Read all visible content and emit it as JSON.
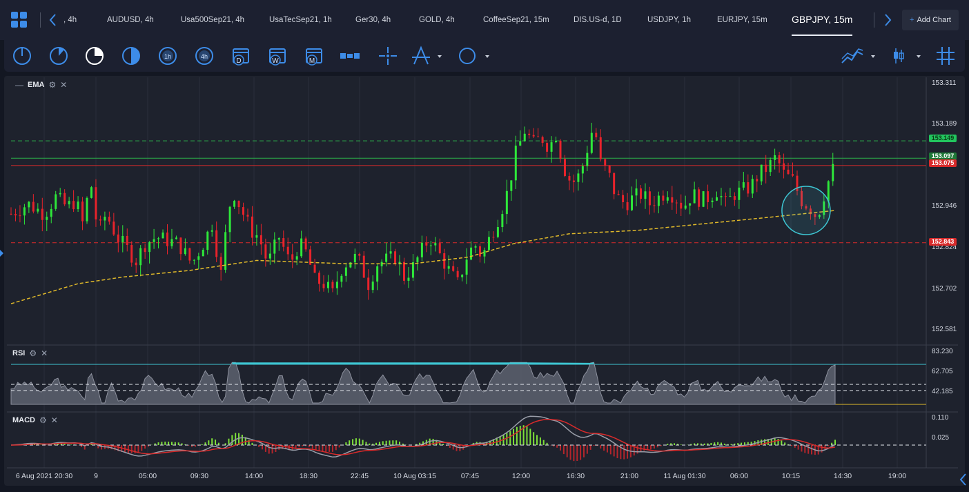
{
  "tabs": [
    {
      "label": ", 4h",
      "x": 92
    },
    {
      "label": "AUDUSD, 4h",
      "x": 155
    },
    {
      "label": "Usa500Sep21, 4h",
      "x": 262
    },
    {
      "label": "UsaTecSep21, 1h",
      "x": 390
    },
    {
      "label": "Ger30, 4h",
      "x": 515
    },
    {
      "label": "GOLD, 4h",
      "x": 607
    },
    {
      "label": "CoffeeSep21, 15m",
      "x": 700
    },
    {
      "label": "DIS.US-d, 1D",
      "x": 831
    },
    {
      "label": "USDJPY, 1h",
      "x": 938
    },
    {
      "label": "EURJPY, 15m",
      "x": 1039
    },
    {
      "label": "GBPJPY, 15m",
      "x": 1147,
      "active": true
    }
  ],
  "add_chart_label": "Add Chart",
  "toolbar": {
    "tools": [
      {
        "name": "period-1-icon",
        "label": ""
      },
      {
        "name": "period-2-icon",
        "label": ""
      },
      {
        "name": "period-3-icon",
        "label": ""
      },
      {
        "name": "period-half-icon",
        "label": ""
      },
      {
        "name": "period-1h-icon",
        "label": "1h"
      },
      {
        "name": "period-4h-icon",
        "label": "4h"
      },
      {
        "name": "calendar-day-icon",
        "label": "D"
      },
      {
        "name": "calendar-week-icon",
        "label": "W"
      },
      {
        "name": "calendar-month-icon",
        "label": "M"
      }
    ]
  },
  "indicators": {
    "ema_label": "EMA",
    "rsi_label": "RSI",
    "macd_label": "MACD"
  },
  "price_axis": [
    "153.311",
    "153.189",
    "152.946",
    "152.824",
    "152.702",
    "152.581"
  ],
  "price_tags": [
    {
      "value": "153.149",
      "color": "#22c55e",
      "text_color": "#0b3d17"
    },
    {
      "value": "153.097",
      "color": "#1f7a38",
      "text_color": "#ffffff"
    },
    {
      "value": "153.075",
      "color": "#d92b2b",
      "text_color": "#ffffff"
    },
    {
      "value": "152.843",
      "color": "#d92b2b",
      "text_color": "#ffffff"
    }
  ],
  "rsi_axis": [
    "83.230",
    "62.705",
    "42.185"
  ],
  "macd_axis": [
    "0.110",
    "0.025"
  ],
  "time_axis": [
    "6 Aug 2021 20:30",
    "9",
    "05:00",
    "09:30",
    "14:00",
    "18:30",
    "22:45",
    "10 Aug 03:15",
    "07:45",
    "12:00",
    "16:30",
    "21:00",
    "11 Aug 01:30",
    "06:00",
    "10:15",
    "14:30",
    "19:00"
  ],
  "colors": {
    "up": "#2ee83a",
    "down": "#e8232b",
    "ema": "#e0b92a",
    "accent": "#3d8ce8",
    "circle": "#3ec7d4"
  },
  "chart_data": {
    "type": "candlestick",
    "symbol": "GBPJPY, 15m",
    "ylim": [
      152.54,
      153.34
    ],
    "horizontal_lines": [
      {
        "value": 153.149,
        "color": "green",
        "style": "dashed"
      },
      {
        "value": 153.097,
        "color": "green",
        "style": "solid"
      },
      {
        "value": 153.075,
        "color": "red",
        "style": "solid"
      },
      {
        "value": 152.843,
        "color": "red",
        "style": "dashed"
      }
    ],
    "close_path": [
      [
        0,
        152.93
      ],
      [
        15,
        152.96
      ],
      [
        30,
        152.93
      ],
      [
        40,
        152.98
      ],
      [
        50,
        152.95
      ],
      [
        58,
        152.97
      ],
      [
        66,
        152.88
      ],
      [
        70,
        153.06
      ],
      [
        78,
        152.87
      ],
      [
        85,
        152.93
      ],
      [
        95,
        152.86
      ],
      [
        105,
        152.82
      ],
      [
        112,
        152.79
      ],
      [
        120,
        152.84
      ],
      [
        130,
        152.86
      ],
      [
        140,
        152.85
      ],
      [
        150,
        152.84
      ],
      [
        162,
        152.78
      ],
      [
        172,
        152.84
      ],
      [
        180,
        152.9
      ],
      [
        188,
        152.75
      ],
      [
        195,
        152.95
      ],
      [
        200,
        152.99
      ],
      [
        208,
        152.93
      ],
      [
        215,
        152.88
      ],
      [
        222,
        152.86
      ],
      [
        230,
        152.78
      ],
      [
        240,
        152.86
      ],
      [
        250,
        152.78
      ],
      [
        258,
        152.84
      ],
      [
        265,
        152.81
      ],
      [
        272,
        152.73
      ],
      [
        280,
        152.72
      ],
      [
        288,
        152.69
      ],
      [
        295,
        152.76
      ],
      [
        302,
        152.79
      ],
      [
        310,
        152.8
      ],
      [
        320,
        152.72
      ],
      [
        328,
        152.78
      ],
      [
        335,
        152.79
      ],
      [
        345,
        152.8
      ],
      [
        352,
        152.74
      ],
      [
        360,
        152.77
      ],
      [
        368,
        152.82
      ],
      [
        375,
        152.86
      ],
      [
        385,
        152.8
      ],
      [
        392,
        152.76
      ],
      [
        400,
        152.72
      ],
      [
        408,
        152.8
      ],
      [
        415,
        152.84
      ],
      [
        422,
        152.8
      ],
      [
        430,
        152.87
      ],
      [
        438,
        152.93
      ],
      [
        445,
        153.0
      ],
      [
        452,
        153.11
      ],
      [
        460,
        153.18
      ],
      [
        468,
        153.14
      ],
      [
        475,
        153.16
      ],
      [
        482,
        153.13
      ],
      [
        488,
        153.17
      ],
      [
        495,
        153.07
      ],
      [
        502,
        153.02
      ],
      [
        510,
        153.05
      ],
      [
        518,
        153.15
      ],
      [
        522,
        153.2
      ],
      [
        528,
        153.08
      ],
      [
        535,
        153.05
      ],
      [
        542,
        152.98
      ],
      [
        550,
        152.96
      ],
      [
        558,
        152.98
      ],
      [
        565,
        152.99
      ],
      [
        572,
        152.96
      ],
      [
        580,
        152.98
      ],
      [
        588,
        153.0
      ],
      [
        595,
        152.98
      ],
      [
        602,
        152.95
      ],
      [
        610,
        152.99
      ],
      [
        618,
        152.97
      ],
      [
        625,
        152.98
      ],
      [
        632,
        153.0
      ],
      [
        640,
        152.96
      ],
      [
        648,
        152.99
      ],
      [
        655,
        153.0
      ],
      [
        662,
        153.01
      ],
      [
        670,
        153.05
      ],
      [
        678,
        153.07
      ],
      [
        685,
        153.1
      ],
      [
        692,
        153.05
      ],
      [
        700,
        153.03
      ],
      [
        708,
        152.97
      ],
      [
        715,
        152.95
      ],
      [
        722,
        152.92
      ],
      [
        730,
        153.01
      ],
      [
        738,
        153.08
      ]
    ],
    "ema_path": [
      [
        0,
        152.66
      ],
      [
        60,
        152.72
      ],
      [
        100,
        152.74
      ],
      [
        160,
        152.76
      ],
      [
        220,
        152.79
      ],
      [
        300,
        152.78
      ],
      [
        360,
        152.78
      ],
      [
        410,
        152.8
      ],
      [
        450,
        152.84
      ],
      [
        500,
        152.87
      ],
      [
        560,
        152.88
      ],
      [
        620,
        152.9
      ],
      [
        680,
        152.92
      ],
      [
        738,
        152.94
      ]
    ],
    "highlight_circle": {
      "x": 712,
      "y": 152.94
    }
  }
}
